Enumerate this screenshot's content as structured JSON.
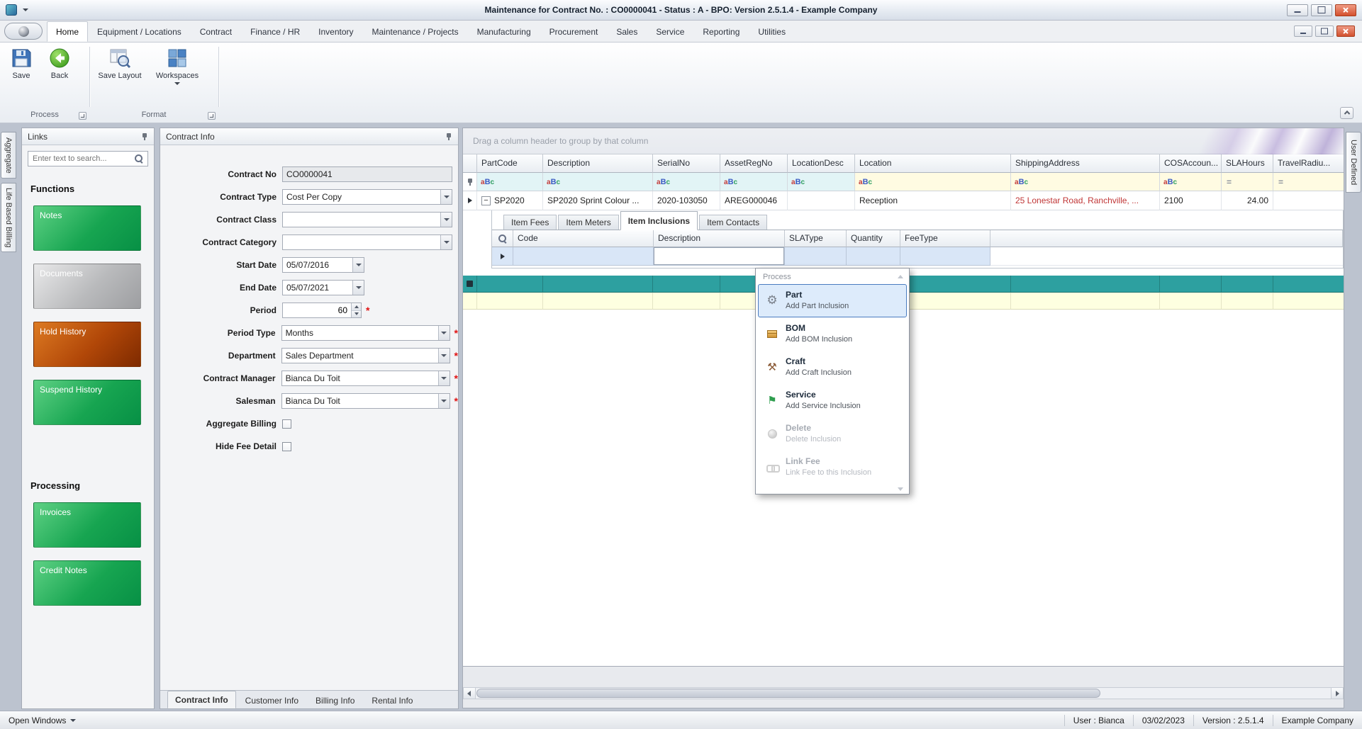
{
  "window": {
    "title": "Maintenance for Contract No. : CO0000041 - Status : A - BPO: Version 2.5.1.4 - Example Company"
  },
  "ribbon": {
    "tabs": [
      "Home",
      "Equipment / Locations",
      "Contract",
      "Finance / HR",
      "Inventory",
      "Maintenance / Projects",
      "Manufacturing",
      "Procurement",
      "Sales",
      "Service",
      "Reporting",
      "Utilities"
    ],
    "active_tab": "Home",
    "buttons": {
      "save": "Save",
      "back": "Back",
      "save_layout": "Save Layout",
      "workspaces": "Workspaces"
    },
    "groups": {
      "process": "Process",
      "format": "Format"
    }
  },
  "side_tabs": {
    "left": [
      "Aggregate",
      "Life Based Billing"
    ],
    "right": [
      "User Defined"
    ]
  },
  "links": {
    "title": "Links",
    "search_placeholder": "Enter text to search...",
    "functions_heading": "Functions",
    "processing_heading": "Processing",
    "buttons": {
      "notes": "Notes",
      "documents": "Documents",
      "hold_history": "Hold History",
      "suspend_history": "Suspend History",
      "invoices": "Invoices",
      "credit_notes": "Credit Notes"
    }
  },
  "contract": {
    "title": "Contract Info",
    "fields": {
      "contract_no": {
        "label": "Contract No",
        "value": "CO0000041"
      },
      "contract_type": {
        "label": "Contract Type",
        "value": "Cost Per Copy"
      },
      "contract_class": {
        "label": "Contract Class",
        "value": ""
      },
      "contract_category": {
        "label": "Contract Category",
        "value": ""
      },
      "start_date": {
        "label": "Start Date",
        "value": "05/07/2016"
      },
      "end_date": {
        "label": "End Date",
        "value": "05/07/2021"
      },
      "period": {
        "label": "Period",
        "value": "60"
      },
      "period_type": {
        "label": "Period Type",
        "value": "Months"
      },
      "department": {
        "label": "Department",
        "value": "Sales Department"
      },
      "contract_manager": {
        "label": "Contract Manager",
        "value": "Bianca Du Toit"
      },
      "salesman": {
        "label": "Salesman",
        "value": "Bianca Du Toit"
      },
      "aggregate_billing": {
        "label": "Aggregate Billing",
        "checked": false
      },
      "hide_fee_detail": {
        "label": "Hide Fee Detail",
        "checked": false
      }
    },
    "tabs": [
      "Contract Info",
      "Customer Info",
      "Billing Info",
      "Rental Info"
    ],
    "active_tab": "Contract Info"
  },
  "grid": {
    "group_hint": "Drag a column header to group by that column",
    "columns": [
      "PartCode",
      "Description",
      "SerialNo",
      "AssetRegNo",
      "LocationDesc",
      "Location",
      "ShippingAddress",
      "COSAccoun...",
      "SLAHours",
      "TravelRadiu..."
    ],
    "row1": {
      "part_code": "SP2020",
      "description": "SP2020 Sprint Colour ...",
      "serial_no": "2020-103050",
      "asset_reg_no": "AREG000046",
      "location_desc": "",
      "location": "Reception",
      "shipping_address": "25 Lonestar Road, Ranchville, ...",
      "cos_account": "2100",
      "sla_hours": "24.00",
      "travel_radius": ""
    },
    "detail": {
      "tabs": [
        "Item Fees",
        "Item Meters",
        "Item Inclusions",
        "Item Contacts"
      ],
      "active_tab": "Item Inclusions",
      "columns": [
        "Code",
        "Description",
        "SLAType",
        "Quantity",
        "FeeType"
      ]
    }
  },
  "menu": {
    "title": "Process",
    "items": {
      "part": {
        "label": "Part",
        "desc": "Add Part Inclusion",
        "enabled": true,
        "selected": true
      },
      "bom": {
        "label": "BOM",
        "desc": "Add BOM Inclusion",
        "enabled": true
      },
      "craft": {
        "label": "Craft",
        "desc": "Add Craft Inclusion",
        "enabled": true
      },
      "service": {
        "label": "Service",
        "desc": "Add Service Inclusion",
        "enabled": true
      },
      "delete": {
        "label": "Delete",
        "desc": "Delete Inclusion",
        "enabled": false
      },
      "link_fee": {
        "label": "Link Fee",
        "desc": "Link Fee to this Inclusion",
        "enabled": false
      }
    }
  },
  "status": {
    "open_windows": "Open Windows",
    "user": "User : Bianca",
    "date": "03/02/2023",
    "version": "Version : 2.5.1.4",
    "company": "Example Company"
  },
  "icons": {
    "save": "floppy-disk",
    "back": "green-left-arrow",
    "save_layout": "window-magnifier",
    "workspaces": "tile-grid",
    "search": "magnifier",
    "pin": "pushpin",
    "text_filter": "aBc",
    "numeric_filter": "=",
    "part": "gears",
    "bom": "box",
    "craft": "hammer-and-pick",
    "service": "flag",
    "delete": "gray-sphere",
    "link_fee": "chain-links"
  }
}
